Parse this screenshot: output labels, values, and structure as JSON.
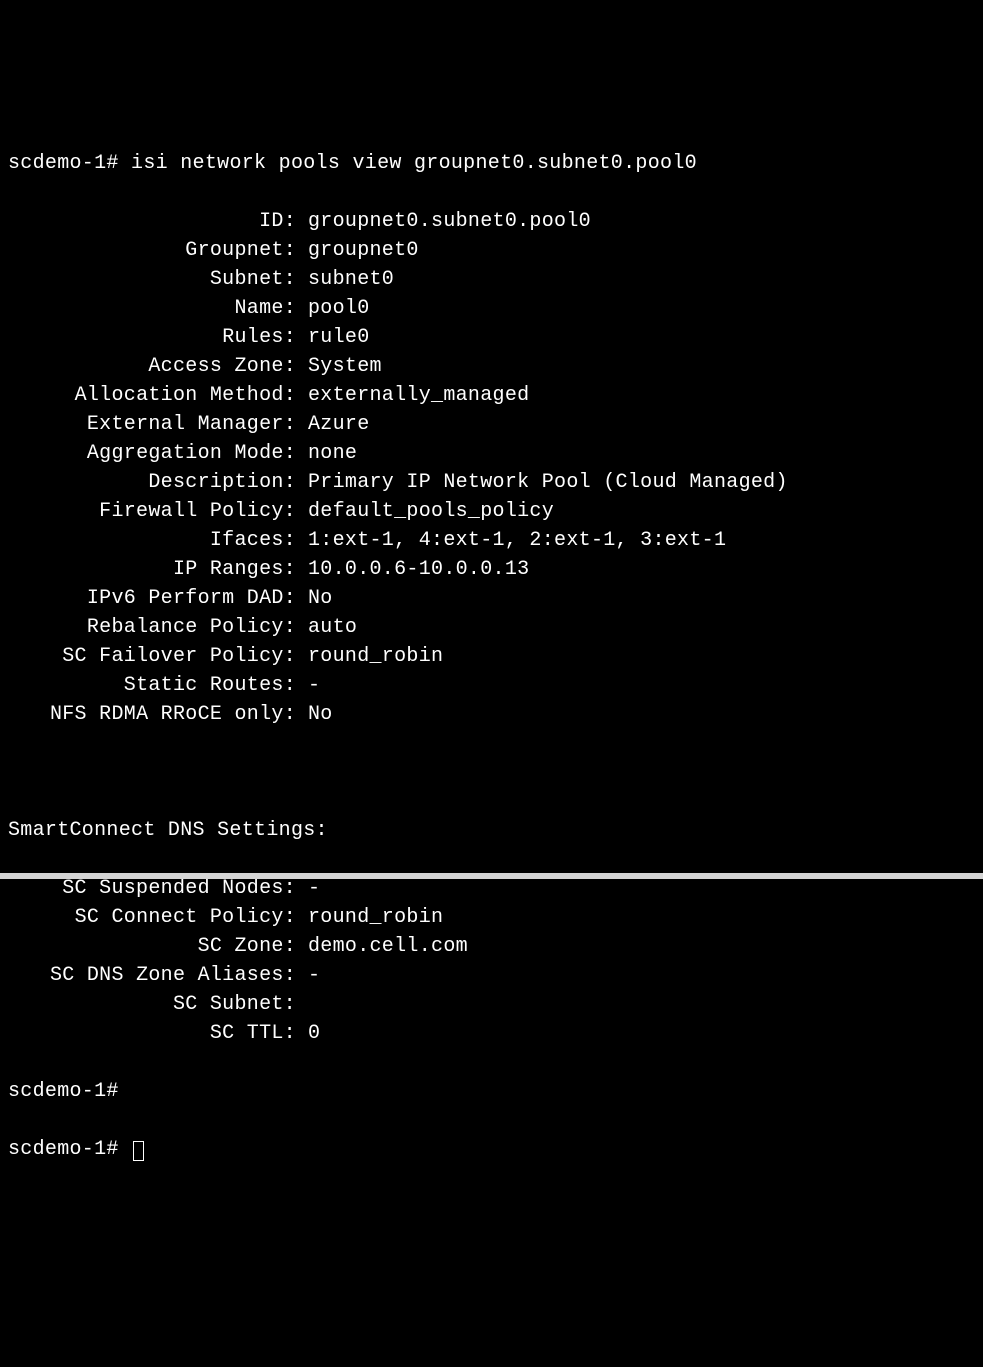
{
  "prompt": "scdemo-1#",
  "command": "isi network pools view groupnet0.subnet0.pool0",
  "fields": [
    {
      "label": "ID:",
      "value": "groupnet0.subnet0.pool0"
    },
    {
      "label": "Groupnet:",
      "value": "groupnet0"
    },
    {
      "label": "Subnet:",
      "value": "subnet0"
    },
    {
      "label": "Name:",
      "value": "pool0"
    },
    {
      "label": "Rules:",
      "value": "rule0"
    },
    {
      "label": "Access Zone:",
      "value": "System"
    },
    {
      "label": "Allocation Method:",
      "value": "externally_managed"
    },
    {
      "label": "External Manager:",
      "value": "Azure"
    },
    {
      "label": "Aggregation Mode:",
      "value": "none"
    },
    {
      "label": "Description:",
      "value": "Primary IP Network Pool (Cloud Managed)"
    },
    {
      "label": "Firewall Policy:",
      "value": "default_pools_policy"
    },
    {
      "label": "Ifaces:",
      "value": "1:ext-1, 4:ext-1, 2:ext-1, 3:ext-1"
    },
    {
      "label": "IP Ranges:",
      "value": "10.0.0.6-10.0.0.13"
    },
    {
      "label": "IPv6 Perform DAD:",
      "value": "No"
    },
    {
      "label": "Rebalance Policy:",
      "value": "auto"
    },
    {
      "label": "SC Failover Policy:",
      "value": "round_robin"
    },
    {
      "label": "Static Routes:",
      "value": "-"
    },
    {
      "label": "NFS RDMA RRoCE only:",
      "value": "No"
    }
  ],
  "dnsHeader": "SmartConnect DNS Settings:",
  "dnsFields": [
    {
      "label": "SC Suspended Nodes:",
      "value": "-"
    },
    {
      "label": "SC Connect Policy:",
      "value": "round_robin"
    },
    {
      "label": "SC Zone:",
      "value": "demo.cell.com"
    },
    {
      "label": "SC DNS Zone Aliases:",
      "value": "-"
    },
    {
      "label": "SC Subnet:",
      "value": ""
    },
    {
      "label": "SC TTL:",
      "value": "0"
    }
  ]
}
